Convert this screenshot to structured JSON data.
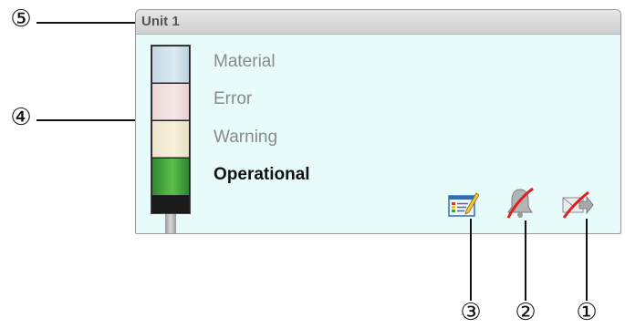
{
  "panel": {
    "title": "Unit 1"
  },
  "lamps": [
    {
      "label": "Material",
      "active": false
    },
    {
      "label": "Error",
      "active": false
    },
    {
      "label": "Warning",
      "active": false
    },
    {
      "label": "Operational",
      "active": true
    }
  ],
  "icons": {
    "edit": "edit-report-icon",
    "alarm_off": "bell-disabled-icon",
    "mail_off": "mail-forward-disabled-icon"
  },
  "callouts": {
    "c1": "①",
    "c2": "②",
    "c3": "③",
    "c4": "④",
    "c5": "⑤"
  },
  "colors": {
    "panel_bg": "#e8fbfb",
    "operational_green": "#4caf3f",
    "disabled_red": "#e02020"
  }
}
